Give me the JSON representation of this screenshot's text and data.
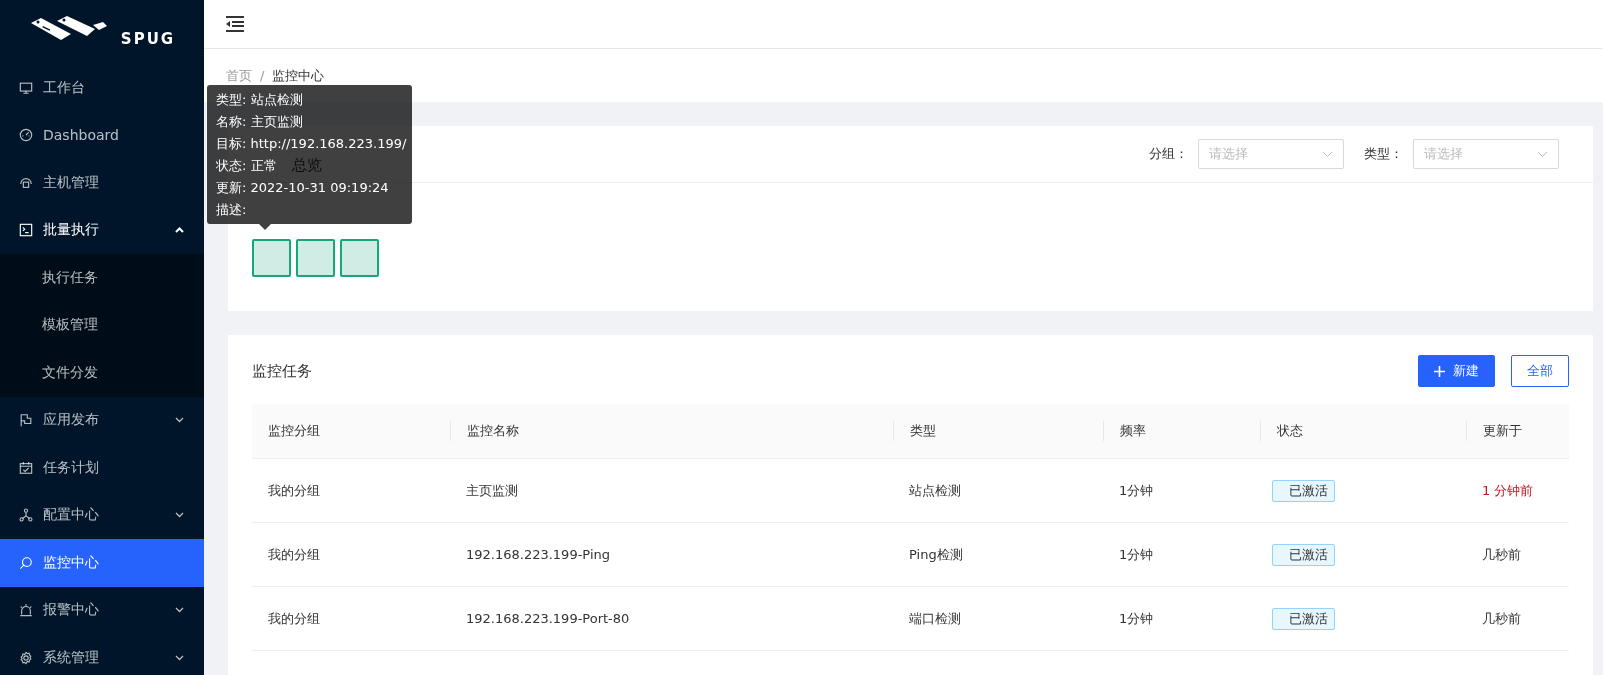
{
  "sidebar": {
    "logo": "SPUG",
    "items": [
      {
        "label": "工作台",
        "selected": false
      },
      {
        "label": "Dashboard",
        "selected": false
      },
      {
        "label": "主机管理",
        "selected": false
      },
      {
        "label": "批量执行",
        "selected": false,
        "expanded": true,
        "children": [
          {
            "label": "执行任务",
            "selected": false
          },
          {
            "label": "模板管理",
            "selected": false
          },
          {
            "label": "文件分发",
            "selected": false
          }
        ]
      },
      {
        "label": "应用发布",
        "selected": false,
        "expanded": false
      },
      {
        "label": "任务计划",
        "selected": false
      },
      {
        "label": "配置中心",
        "selected": false,
        "expanded": false
      },
      {
        "label": "监控中心",
        "selected": true
      },
      {
        "label": "报警中心",
        "selected": false,
        "expanded": false
      },
      {
        "label": "系统管理",
        "selected": false,
        "expanded": false
      }
    ]
  },
  "breadcrumb": {
    "items": [
      "首页",
      "监控中心"
    ],
    "separator": "/"
  },
  "overview": {
    "title": "总览",
    "filters": [
      {
        "label": "分组：",
        "placeholder": "请选择"
      },
      {
        "label": "类型：",
        "placeholder": "请选择"
      }
    ],
    "tiles": [
      {
        "color": "#16a57c"
      },
      {
        "color": "#16a57c"
      },
      {
        "color": "#16a57c"
      }
    ],
    "tooltip": [
      "类型: 站点检测",
      "名称: 主页监测",
      "目标: http://192.168.223.199/",
      "状态: 正常",
      "更新: 2022-10-31 09:19:24",
      "描述:"
    ]
  },
  "tasks": {
    "title": "监控任务",
    "buttons": [
      {
        "label": "新建",
        "kind": "primary"
      },
      {
        "label": "全部",
        "kind": "outline"
      }
    ],
    "columns": [
      "监控分组",
      "监控名称",
      "类型",
      "频率",
      "状态",
      "更新于"
    ],
    "rows": [
      {
        "group": "我的分组",
        "name": "主页监测",
        "type": "站点检测",
        "interval": "1分钟",
        "status": "已激活",
        "updated": "1 分钟前",
        "recent": true
      },
      {
        "group": "我的分组",
        "name": "192.168.223.199-Ping",
        "type": "Ping检测",
        "interval": "1分钟",
        "status": "已激活",
        "updated": "几秒前",
        "recent": false
      },
      {
        "group": "我的分组",
        "name": "192.168.223.199-Port-80",
        "type": "端口检测",
        "interval": "1分钟",
        "status": "已激活",
        "updated": "几秒前",
        "recent": false
      }
    ]
  }
}
